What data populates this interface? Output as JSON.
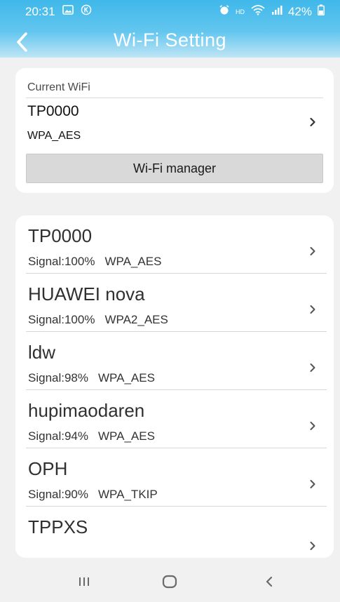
{
  "status_bar": {
    "time": "20:31",
    "icons_left": [
      "image-icon",
      "k-circle-icon"
    ],
    "icons_right": [
      "alarm-icon",
      "hd-icon",
      "wifi-signal-icon",
      "cell-signal-icon",
      "battery-icon"
    ],
    "hd_label": "HD",
    "battery": "42%"
  },
  "header": {
    "title": "Wi-Fi Setting",
    "gradient_top": "#3fb8ea",
    "gradient_bottom": "#bfe5f5"
  },
  "current_wifi": {
    "label": "Current WiFi",
    "ssid": "TP0000",
    "security": "WPA_AES",
    "manager_button": "Wi-Fi manager"
  },
  "wifi_list": [
    {
      "ssid": "TP0000",
      "signal": "Signal:100%",
      "security": "WPA_AES"
    },
    {
      "ssid": "HUAWEI nova",
      "signal": "Signal:100%",
      "security": "WPA2_AES"
    },
    {
      "ssid": "ldw",
      "signal": "Signal:98%",
      "security": "WPA_AES"
    },
    {
      "ssid": "hupimaodaren",
      "signal": "Signal:94%",
      "security": "WPA_AES"
    },
    {
      "ssid": "OPH",
      "signal": "Signal:90%",
      "security": "WPA_TKIP"
    },
    {
      "ssid": "TPPXS",
      "signal": "",
      "security": ""
    }
  ],
  "nav_bar": {
    "buttons": [
      "recent-apps-icon",
      "home-icon",
      "back-icon"
    ]
  }
}
